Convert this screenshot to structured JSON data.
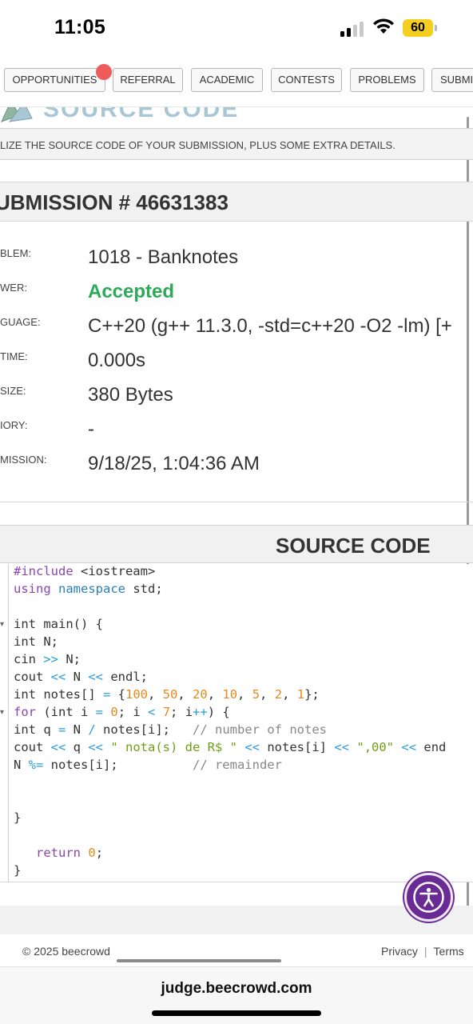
{
  "status": {
    "time": "11:05",
    "battery": "60"
  },
  "nav": {
    "tabs": [
      "OPPORTUNITIES",
      "REFERRAL",
      "ACADEMIC",
      "CONTESTS",
      "PROBLEMS",
      "SUBMI"
    ]
  },
  "header": {
    "logo_text": "SOURCE CODE",
    "subtitle": "LIZE THE SOURCE CODE OF YOUR SUBMISSION, PLUS SOME EXTRA DETAILS."
  },
  "submission": {
    "title": "UBMISSION # 46631383",
    "fields": [
      {
        "label": "BLEM:",
        "value": "1018 - Banknotes"
      },
      {
        "label": "WER:",
        "value": "Accepted"
      },
      {
        "label": "GUAGE:",
        "value": "C++20 (g++ 11.3.0, -std=c++20 -O2 -lm) [+"
      },
      {
        "label": "TIME:",
        "value": "0.000s"
      },
      {
        "label": "SIZE:",
        "value": "380 Bytes"
      },
      {
        "label": "IORY:",
        "value": "-"
      },
      {
        "label": "MISSION:",
        "value": "9/18/25, 1:04:36 AM"
      }
    ]
  },
  "source": {
    "title": "SOURCE CODE",
    "lines": [
      "#include <iostream>",
      "using namespace std;",
      "",
      "int main() {",
      "int N;",
      "cin >> N;",
      "cout << N << endl;",
      "int notes[] = {100, 50, 20, 10, 5, 2, 1};",
      "for (int i = 0; i < 7; i++) {",
      "int q = N / notes[i];   // number of notes",
      "cout << q << \" nota(s) de R$ \" << notes[i] << \",00\" << end",
      "N %= notes[i];          // remainder",
      "",
      "",
      "}",
      "",
      "   return 0;",
      "}"
    ]
  },
  "footer": {
    "copyright": "© 2025 beecrowd",
    "privacy": "Privacy",
    "separator": "|",
    "terms": "Terms"
  },
  "browser": {
    "url": "judge.beecrowd.com"
  }
}
